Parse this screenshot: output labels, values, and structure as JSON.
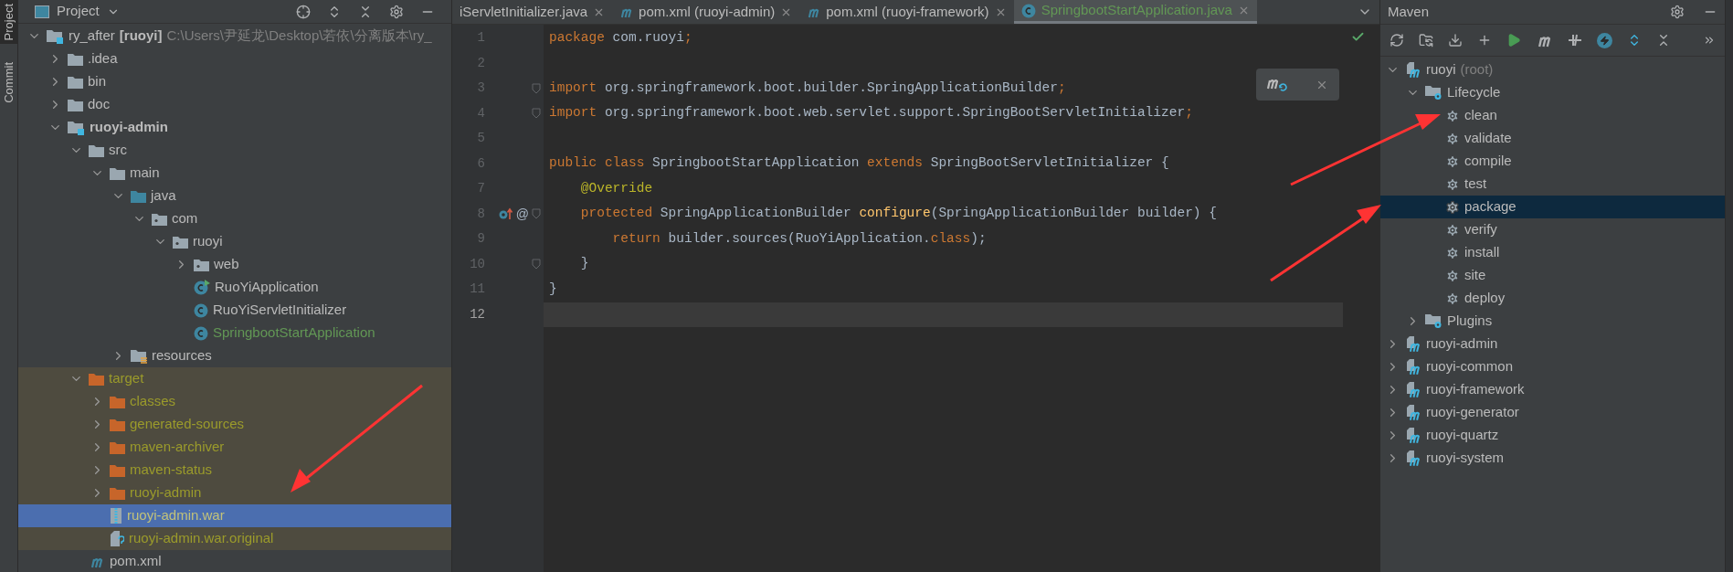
{
  "side_tabs": [
    {
      "label": "Project",
      "selected": true
    },
    {
      "label": "Commit",
      "selected": false
    }
  ],
  "project_panel": {
    "title": "Project",
    "tree": [
      {
        "kind": "module",
        "label": "ry_after",
        "module": "[ruoyi]",
        "path": "C:\\Users\\尹延龙\\Desktop\\若依\\分离版本\\ry_",
        "expanded": true,
        "selected": false,
        "excluded": false,
        "added": false,
        "children": [
          {
            "kind": "folder",
            "label": ".idea",
            "expanded": false,
            "selected": false,
            "excluded": false,
            "added": false
          },
          {
            "kind": "folder",
            "label": "bin",
            "expanded": false,
            "selected": false,
            "excluded": false,
            "added": false
          },
          {
            "kind": "folder",
            "label": "doc",
            "expanded": false,
            "selected": false,
            "excluded": false,
            "added": false
          },
          {
            "kind": "module",
            "module": "ruoyi-admin",
            "expanded": true,
            "selected": false,
            "excluded": false,
            "added": false,
            "children": [
              {
                "kind": "folder",
                "label": "src",
                "expanded": true,
                "selected": false,
                "excluded": false,
                "added": false,
                "children": [
                  {
                    "kind": "folder",
                    "label": "main",
                    "expanded": true,
                    "selected": false,
                    "excluded": false,
                    "added": false,
                    "children": [
                      {
                        "kind": "source-folder",
                        "label": "java",
                        "expanded": true,
                        "selected": false,
                        "excluded": false,
                        "added": false,
                        "children": [
                          {
                            "kind": "package",
                            "label": "com",
                            "expanded": true,
                            "selected": false,
                            "excluded": false,
                            "added": false,
                            "children": [
                              {
                                "kind": "package",
                                "label": "ruoyi",
                                "expanded": true,
                                "selected": false,
                                "excluded": false,
                                "added": false,
                                "children": [
                                  {
                                    "kind": "package",
                                    "label": "web",
                                    "expanded": false,
                                    "selected": false,
                                    "excluded": false,
                                    "added": false
                                  },
                                  {
                                    "kind": "spring-class",
                                    "label": "RuoYiApplication",
                                    "selected": false,
                                    "excluded": false,
                                    "added": false
                                  },
                                  {
                                    "kind": "class",
                                    "label": "RuoYiServletInitializer",
                                    "selected": false,
                                    "excluded": false,
                                    "added": false
                                  },
                                  {
                                    "kind": "class",
                                    "label": "SpringbootStartApplication",
                                    "selected": false,
                                    "excluded": false,
                                    "added": true
                                  }
                                ]
                              }
                            ]
                          }
                        ]
                      },
                      {
                        "kind": "resources",
                        "label": "resources",
                        "expanded": false,
                        "selected": false,
                        "excluded": false,
                        "added": false
                      }
                    ]
                  }
                ]
              },
              {
                "kind": "excluded-folder",
                "label": "target",
                "expanded": true,
                "selected": false,
                "excluded": true,
                "added": false,
                "children": [
                  {
                    "kind": "excluded-folder",
                    "label": "classes",
                    "expanded": false,
                    "selected": false,
                    "excluded": true,
                    "added": false
                  },
                  {
                    "kind": "excluded-folder",
                    "label": "generated-sources",
                    "expanded": false,
                    "selected": false,
                    "excluded": true,
                    "added": false
                  },
                  {
                    "kind": "excluded-folder",
                    "label": "maven-archiver",
                    "expanded": false,
                    "selected": false,
                    "excluded": true,
                    "added": false
                  },
                  {
                    "kind": "excluded-folder",
                    "label": "maven-status",
                    "expanded": false,
                    "selected": false,
                    "excluded": true,
                    "added": false
                  },
                  {
                    "kind": "excluded-folder",
                    "label": "ruoyi-admin",
                    "expanded": false,
                    "selected": false,
                    "excluded": true,
                    "added": false
                  },
                  {
                    "kind": "war",
                    "label": "ruoyi-admin.war",
                    "selected": true,
                    "excluded": true,
                    "added": false
                  },
                  {
                    "kind": "unknown-file",
                    "label": "ruoyi-admin.war.original",
                    "selected": false,
                    "excluded": true,
                    "added": false
                  }
                ]
              },
              {
                "kind": "maven-file",
                "label": "pom.xml",
                "selected": false,
                "excluded": false,
                "added": false
              }
            ]
          }
        ]
      }
    ]
  },
  "editor": {
    "tabs": [
      {
        "kind": "class",
        "label": "iServletInitializer.java",
        "selected": false
      },
      {
        "kind": "maven",
        "label": "pom.xml (ruoyi-admin)",
        "selected": false
      },
      {
        "kind": "maven",
        "label": "pom.xml (ruoyi-framework)",
        "selected": false
      },
      {
        "kind": "class",
        "label": "SpringbootStartApplication.java",
        "selected": true
      }
    ],
    "lines": [
      {
        "number": "1",
        "current": false,
        "fold": false,
        "tokens": [
          {
            "kind": "keyword",
            "text": "package"
          },
          {
            "kind": "plain",
            "text": " com.ruoyi"
          },
          {
            "kind": "keyword",
            "text": ";"
          }
        ]
      },
      {
        "number": "2",
        "current": false,
        "fold": false
      },
      {
        "number": "3",
        "current": false,
        "fold": true,
        "tokens": [
          {
            "kind": "keyword",
            "text": "import"
          },
          {
            "kind": "plain",
            "text": " org.springframework.boot.builder.SpringApplicationBuilder"
          },
          {
            "kind": "keyword",
            "text": ";"
          }
        ]
      },
      {
        "number": "4",
        "current": false,
        "fold": true,
        "tokens": [
          {
            "kind": "keyword",
            "text": "import"
          },
          {
            "kind": "plain",
            "text": " org.springframework.boot.web.servlet.support.SpringBootServletInitializer"
          },
          {
            "kind": "keyword",
            "text": ";"
          }
        ]
      },
      {
        "number": "5",
        "current": false,
        "fold": false
      },
      {
        "number": "6",
        "current": false,
        "fold": false,
        "tokens": [
          {
            "kind": "keyword",
            "text": "public class"
          },
          {
            "kind": "plain",
            "text": " SpringbootStartApplication "
          },
          {
            "kind": "keyword",
            "text": "extends"
          },
          {
            "kind": "plain",
            "text": " SpringBootServletInitializer {"
          }
        ]
      },
      {
        "number": "7",
        "current": false,
        "fold": false,
        "tokens": [
          {
            "kind": "annotation",
            "text": "    @Override"
          }
        ]
      },
      {
        "number": "8",
        "current": false,
        "fold": true,
        "gutter_icons": [
          {
            "kind": "override"
          },
          {
            "kind": "annotation",
            "text": "@"
          }
        ],
        "tokens": [
          {
            "kind": "keyword",
            "text": "    protected"
          },
          {
            "kind": "plain",
            "text": " SpringApplicationBuilder "
          },
          {
            "kind": "method",
            "text": "configure"
          },
          {
            "kind": "plain",
            "text": "(SpringApplicationBuilder builder) {"
          }
        ]
      },
      {
        "number": "9",
        "current": false,
        "fold": false,
        "tokens": [
          {
            "kind": "keyword",
            "text": "        return"
          },
          {
            "kind": "plain",
            "text": " builder.sources(RuoYiApplication."
          },
          {
            "kind": "keyword",
            "text": "class"
          },
          {
            "kind": "plain",
            "text": ");"
          }
        ]
      },
      {
        "number": "10",
        "current": false,
        "fold": true,
        "tokens": [
          {
            "kind": "plain",
            "text": "    }"
          }
        ]
      },
      {
        "number": "11",
        "current": false,
        "fold": false,
        "tokens": [
          {
            "kind": "plain",
            "text": "}"
          }
        ]
      },
      {
        "number": "12",
        "current": true,
        "fold": false
      }
    ]
  },
  "maven_panel": {
    "title": "Maven",
    "tree": [
      {
        "kind": "maven-module",
        "label": "ruoyi",
        "note": "(root)",
        "expanded": true,
        "selected": false,
        "children": [
          {
            "kind": "lifecycle",
            "label": "Lifecycle",
            "expanded": true,
            "selected": false,
            "children": [
              {
                "kind": "goal",
                "label": "clean",
                "selected": false
              },
              {
                "kind": "goal",
                "label": "validate",
                "selected": false
              },
              {
                "kind": "goal",
                "label": "compile",
                "selected": false
              },
              {
                "kind": "goal",
                "label": "test",
                "selected": false
              },
              {
                "kind": "goal",
                "label": "package",
                "selected": true
              },
              {
                "kind": "goal",
                "label": "verify",
                "selected": false
              },
              {
                "kind": "goal",
                "label": "install",
                "selected": false
              },
              {
                "kind": "goal",
                "label": "site",
                "selected": false
              },
              {
                "kind": "goal",
                "label": "deploy",
                "selected": false
              }
            ]
          },
          {
            "kind": "lifecycle",
            "label": "Plugins",
            "expanded": false,
            "selected": false
          }
        ]
      },
      {
        "kind": "maven-module",
        "label": "ruoyi-admin",
        "expanded": false,
        "selected": false
      },
      {
        "kind": "maven-module",
        "label": "ruoyi-common",
        "expanded": false,
        "selected": false
      },
      {
        "kind": "maven-module",
        "label": "ruoyi-framework",
        "expanded": false,
        "selected": false
      },
      {
        "kind": "maven-module",
        "label": "ruoyi-generator",
        "expanded": false,
        "selected": false
      },
      {
        "kind": "maven-module",
        "label": "ruoyi-quartz",
        "expanded": false,
        "selected": false
      },
      {
        "kind": "maven-module",
        "label": "ruoyi-system",
        "expanded": false,
        "selected": false
      }
    ]
  }
}
